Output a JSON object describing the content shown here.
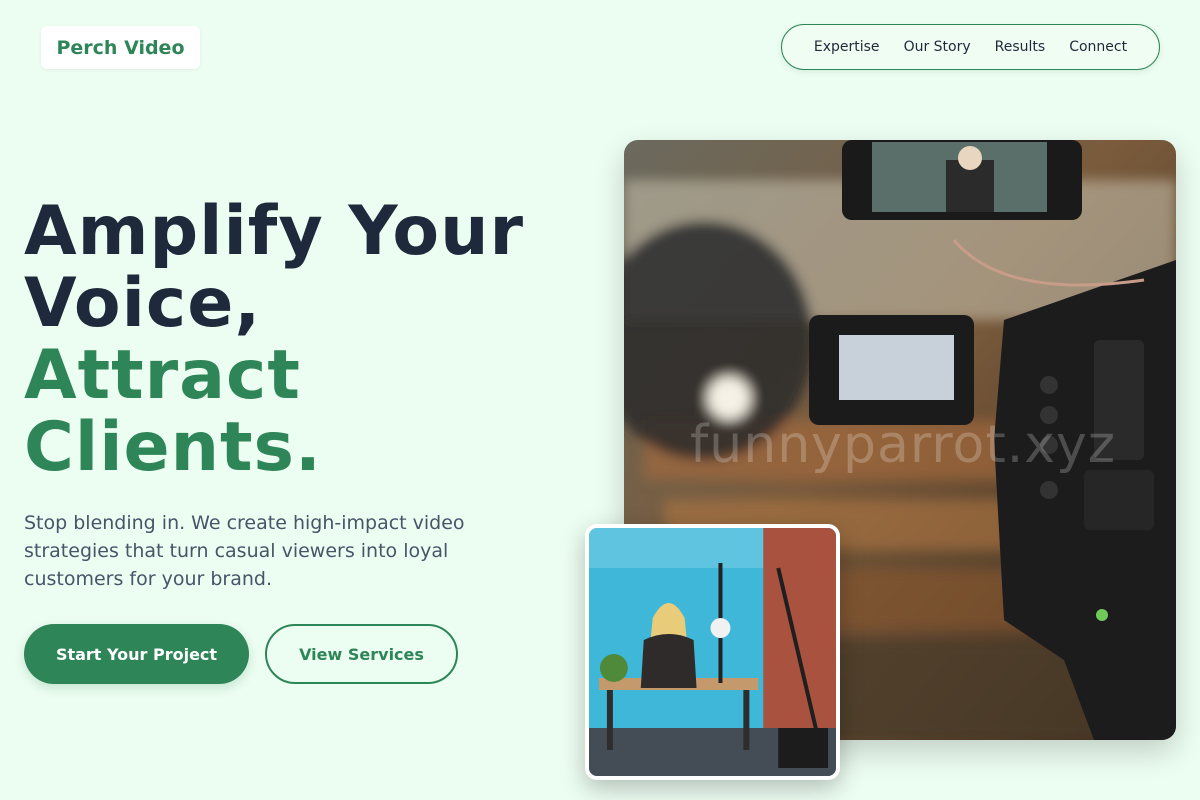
{
  "brand": {
    "name": "Perch Video",
    "accent": "#2e8557",
    "dark": "#1e293b"
  },
  "nav": {
    "items": [
      {
        "label": "Expertise"
      },
      {
        "label": "Our Story"
      },
      {
        "label": "Results"
      },
      {
        "label": "Connect"
      }
    ]
  },
  "hero": {
    "headline_dark_1": "Amplify Your",
    "headline_dark_2": "Voice,",
    "headline_green_1": "Attract",
    "headline_green_2": "Clients.",
    "subtitle": "Stop blending in. We create high-impact video strategies that turn casual viewers into loyal customers for your brand.",
    "primary_cta": "Start Your Project",
    "secondary_cta": "View Services"
  },
  "images": {
    "main": {
      "subject": "camera-filming-interview",
      "watermark": "funnyparrot.xyz"
    },
    "inset": {
      "subject": "woman-at-desk-studio"
    }
  }
}
